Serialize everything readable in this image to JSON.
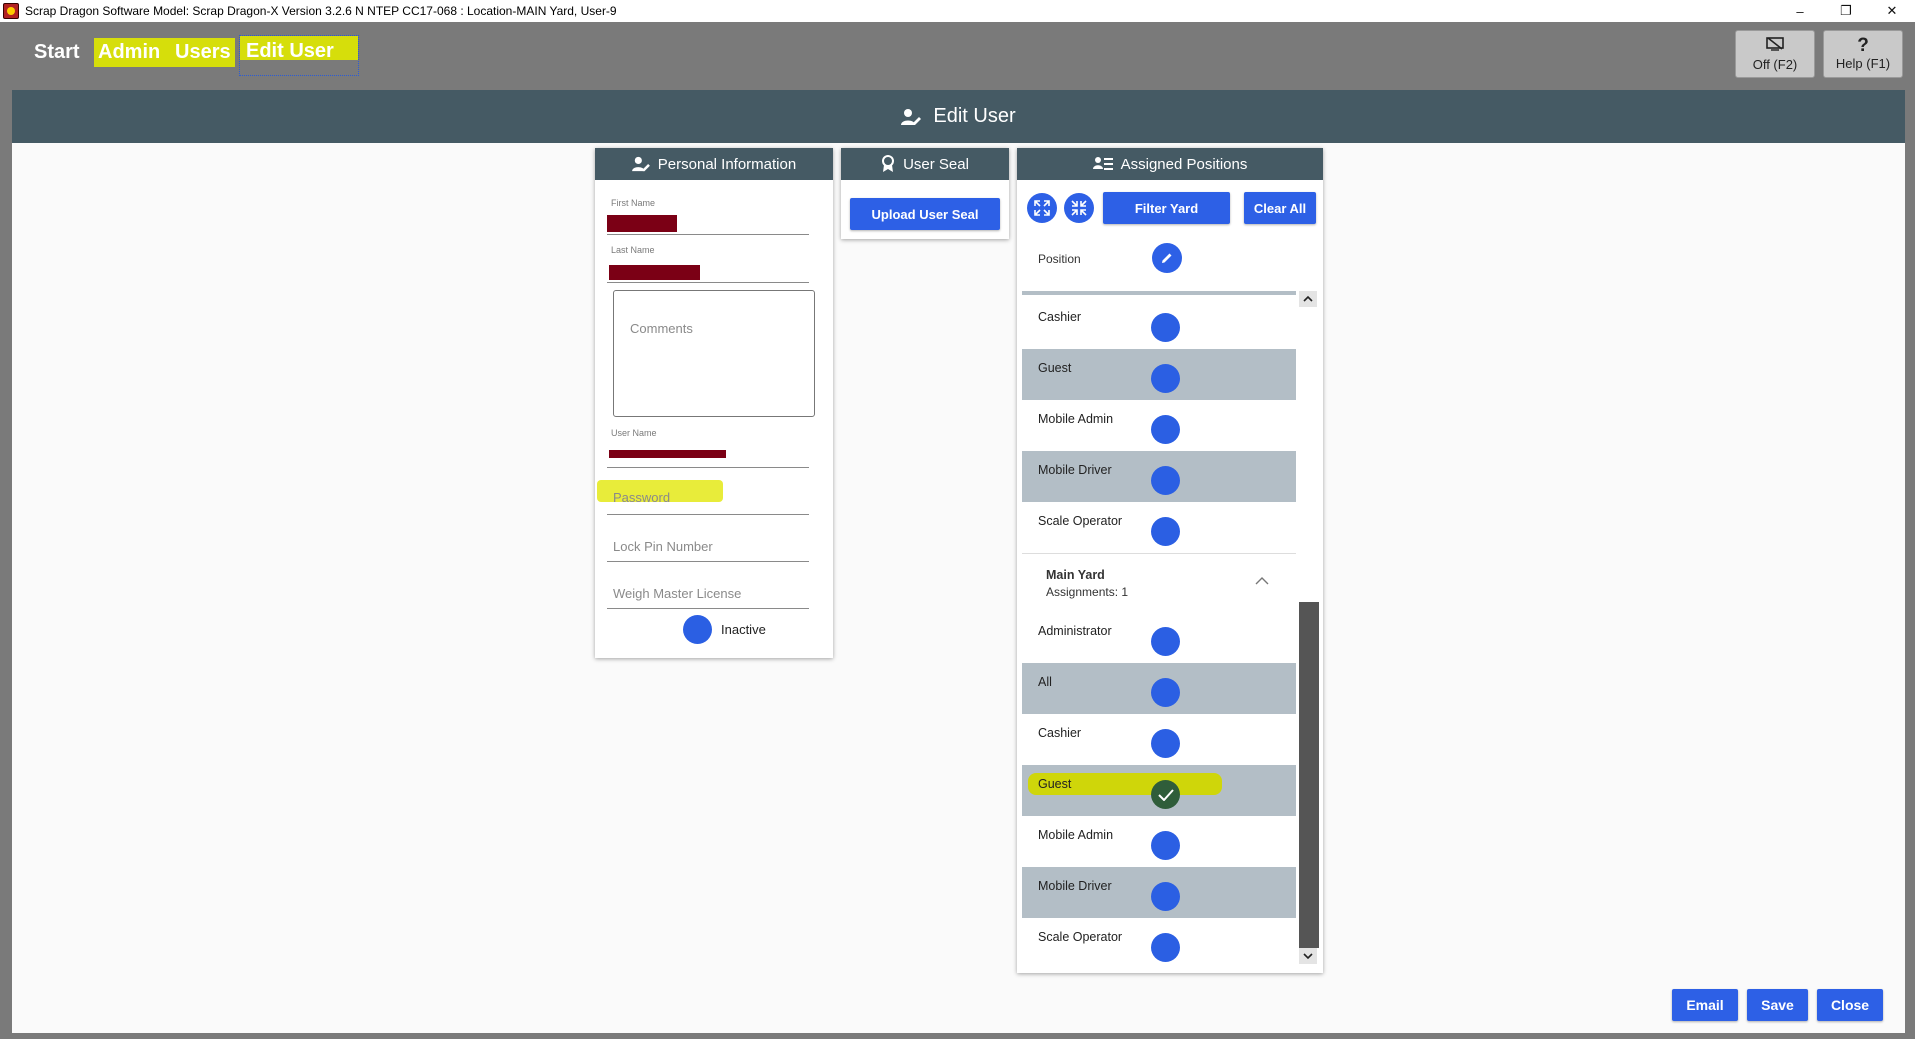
{
  "window": {
    "title": "Scrap Dragon Software Model: Scrap Dragon-X Version 3.2.6 N NTEP CC17-068 : Location-MAIN Yard, User-9",
    "minimize": "–",
    "restore": "❐",
    "close": "✕"
  },
  "nav": {
    "start": "Start",
    "admin": "Admin",
    "users": "Users",
    "edit_user": "Edit User"
  },
  "toolbar": {
    "off_label": "Off (F2)",
    "help_label": "Help (F1)",
    "help_icon_glyph": "?"
  },
  "page": {
    "title": "Edit User"
  },
  "personal": {
    "title": "Personal Information",
    "first_name_label": "First Name",
    "last_name_label": "Last Name",
    "comments_placeholder": "Comments",
    "user_name_label": "User Name",
    "password_placeholder": "Password",
    "lock_pin_placeholder": "Lock Pin Number",
    "weigh_master_placeholder": "Weigh Master License",
    "inactive_label": "Inactive"
  },
  "seal": {
    "title": "User Seal",
    "upload_label": "Upload User Seal"
  },
  "positions": {
    "title": "Assigned Positions",
    "filter_yard_label": "Filter Yard",
    "clear_all_label": "Clear All",
    "position_header": "Position",
    "group1_items": [
      {
        "name": "Cashier",
        "checked": false
      },
      {
        "name": "Guest",
        "checked": false
      },
      {
        "name": "Mobile Admin",
        "checked": false
      },
      {
        "name": "Mobile Driver",
        "checked": false
      },
      {
        "name": "Scale Operator",
        "checked": false
      }
    ],
    "main_yard": {
      "name": "Main Yard",
      "assignments": "Assignments: 1"
    },
    "group2_items": [
      {
        "name": "Administrator",
        "checked": false
      },
      {
        "name": "All",
        "checked": false
      },
      {
        "name": "Cashier",
        "checked": false
      },
      {
        "name": "Guest",
        "checked": true
      },
      {
        "name": "Mobile Admin",
        "checked": false
      },
      {
        "name": "Mobile Driver",
        "checked": false
      },
      {
        "name": "Scale Operator",
        "checked": false
      }
    ]
  },
  "footer": {
    "email_label": "Email",
    "save_label": "Save",
    "close_label": "Close"
  },
  "colors": {
    "accent_blue": "#2d60e6",
    "header_slate": "#455a64",
    "highlight_yellow": "#d6de0b",
    "redaction": "#7b0015"
  }
}
